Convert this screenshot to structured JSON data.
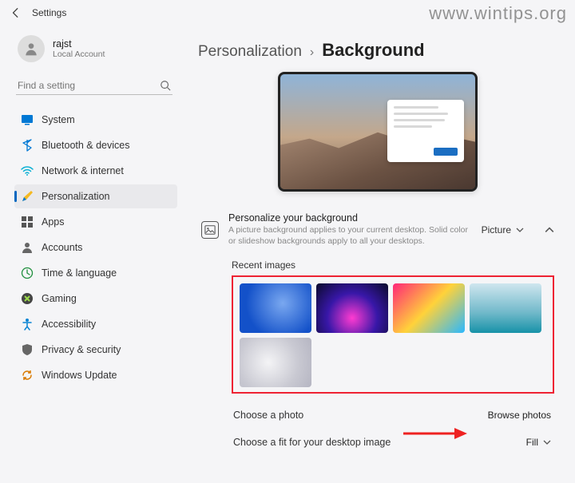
{
  "titlebar": {
    "title": "Settings"
  },
  "user": {
    "name": "rajst",
    "account_type": "Local Account"
  },
  "search": {
    "placeholder": "Find a setting"
  },
  "nav": {
    "items": [
      {
        "label": "System"
      },
      {
        "label": "Bluetooth & devices"
      },
      {
        "label": "Network & internet"
      },
      {
        "label": "Personalization"
      },
      {
        "label": "Apps"
      },
      {
        "label": "Accounts"
      },
      {
        "label": "Time & language"
      },
      {
        "label": "Gaming"
      },
      {
        "label": "Accessibility"
      },
      {
        "label": "Privacy & security"
      },
      {
        "label": "Windows Update"
      }
    ]
  },
  "breadcrumb": {
    "parent": "Personalization",
    "sep": "›",
    "current": "Background"
  },
  "personalize": {
    "title": "Personalize your background",
    "desc": "A picture background applies to your current desktop. Solid color or slideshow backgrounds apply to all your desktops.",
    "selected": "Picture"
  },
  "recent": {
    "heading": "Recent images"
  },
  "choose_photo": {
    "label": "Choose a photo",
    "button": "Browse photos"
  },
  "choose_fit": {
    "label": "Choose a fit for your desktop image",
    "selected": "Fill"
  },
  "watermark": "www.wintips.org"
}
